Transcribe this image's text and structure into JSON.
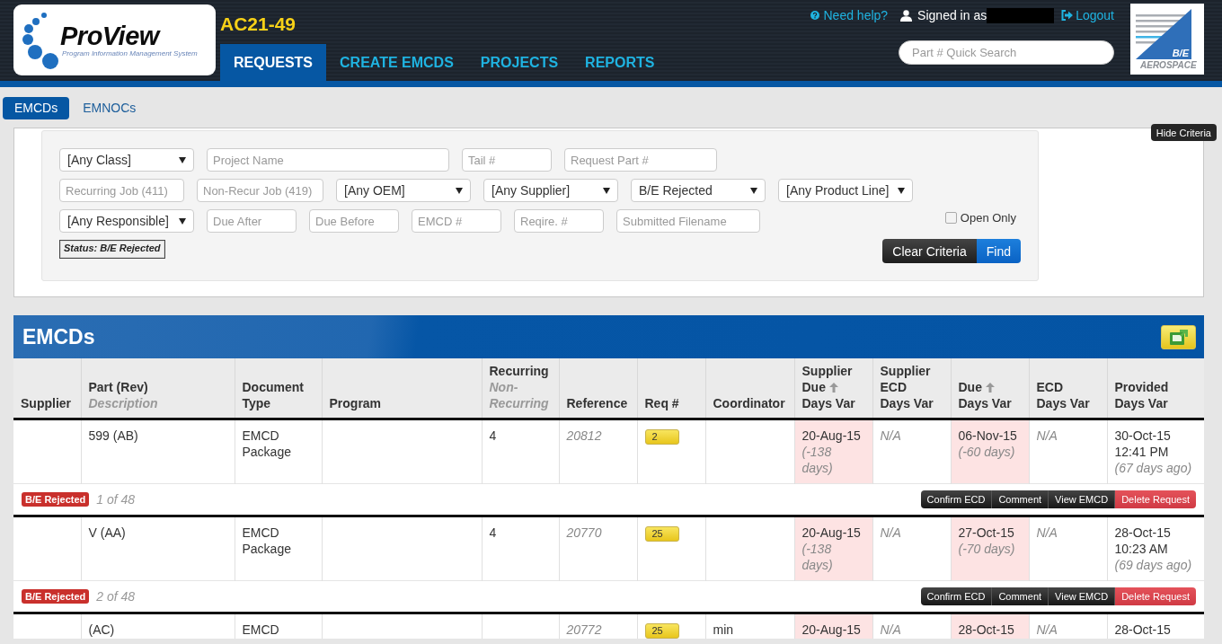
{
  "header": {
    "logo": {
      "name": "ProView",
      "tagline": "Program Information Management System"
    },
    "project_code": "AC21-49",
    "nav": [
      {
        "label": "REQUESTS",
        "selected": true
      },
      {
        "label": "CREATE EMCDS",
        "selected": false
      },
      {
        "label": "PROJECTS",
        "selected": false
      },
      {
        "label": "REPORTS",
        "selected": false
      }
    ],
    "help_link": "Need help?",
    "signed_in_label": "Signed in as",
    "logout_link": "Logout",
    "quick_search": {
      "placeholder": "Part # Quick Search"
    },
    "partner_logo": {
      "mark": "B/E",
      "name": "AEROSPACE"
    }
  },
  "subtabs": [
    {
      "label": "EMCDs",
      "selected": true
    },
    {
      "label": "EMNOCs",
      "selected": false
    }
  ],
  "criteria": {
    "toggle_button": "Hide Criteria",
    "lines": [
      {
        "fields": [
          {
            "kind": "select",
            "value": "[Any Class]"
          },
          {
            "kind": "input",
            "placeholder": "Project Name"
          },
          {
            "kind": "input",
            "placeholder": "Tail #"
          },
          {
            "kind": "input",
            "placeholder": "Request Part #"
          }
        ]
      },
      {
        "fields": [
          {
            "kind": "input",
            "placeholder": "Recurring Job (411)"
          },
          {
            "kind": "input",
            "placeholder": "Non-Recur Job (419)"
          },
          {
            "kind": "select",
            "value": "[Any OEM]"
          },
          {
            "kind": "select",
            "value": "[Any Supplier]"
          },
          {
            "kind": "select",
            "value": "B/E Rejected"
          },
          {
            "kind": "select",
            "value": "[Any Product Line]"
          }
        ]
      },
      {
        "fields": [
          {
            "kind": "select",
            "value": "[Any Responsible]"
          },
          {
            "kind": "input",
            "placeholder": "Due After"
          },
          {
            "kind": "input",
            "placeholder": "Due Before"
          },
          {
            "kind": "input",
            "placeholder": "EMCD #"
          },
          {
            "kind": "input",
            "placeholder": "Reqire. #"
          },
          {
            "kind": "input",
            "placeholder": "Submitted Filename"
          }
        ]
      }
    ],
    "open_only": {
      "label": "Open Only",
      "checked": false
    },
    "status_tag": "Status: B/E Rejected",
    "buttons": [
      {
        "label": "Clear Criteria",
        "kind": "secondary"
      },
      {
        "label": "Find",
        "kind": "primary"
      }
    ]
  },
  "results": {
    "title": "EMCDs",
    "table": {
      "columns": [
        {
          "label": "Supplier",
          "sorted": false
        },
        {
          "label": "Part (Rev)",
          "subtitle": "Description",
          "sorted": false
        },
        {
          "label": "Document Type",
          "sorted": false
        },
        {
          "label": "Program",
          "sorted": false
        },
        {
          "label": "Recurring",
          "subtitle": "Non-Recurring",
          "sorted": false
        },
        {
          "label": "Reference",
          "sorted": false
        },
        {
          "label": "Req #",
          "sorted": false
        },
        {
          "label": "Coordinator",
          "sorted": false
        },
        {
          "label": "Supplier Due",
          "second_line": "Days Var",
          "sorted": true
        },
        {
          "label": "Supplier ECD",
          "second_line": "Days Var",
          "sorted": false
        },
        {
          "label": "Due",
          "second_line": "Days Var",
          "sorted": true
        },
        {
          "label": "ECD",
          "second_line": "Days Var",
          "sorted": false
        },
        {
          "label": "Provided",
          "second_line": "Days Var",
          "sorted": false
        }
      ],
      "rows": [
        {
          "part": "599 (AB)",
          "document_type": "EMCD Package",
          "recurring": "4",
          "reference": "20812",
          "req": "2",
          "supplier_due": {
            "date": "20-Aug-15",
            "variance": "(-138 days)",
            "late": true
          },
          "supplier_ecd": "N/A",
          "due": {
            "date": "06-Nov-15",
            "variance": "(-60 days)",
            "late": true
          },
          "ecd": "N/A",
          "provided": {
            "date": "30-Oct-15",
            "time": "12:41 PM",
            "ago": "(67 days ago)"
          },
          "status": {
            "label": "B/E Rejected",
            "kind": "danger"
          },
          "position": "1 of 48",
          "actions": [
            {
              "label": "Confirm ECD",
              "kind": "default"
            },
            {
              "label": "Comment",
              "kind": "default"
            },
            {
              "label": "View EMCD",
              "kind": "default"
            },
            {
              "label": "Delete Request",
              "kind": "danger"
            }
          ]
        },
        {
          "part": "V (AA)",
          "document_type": "EMCD Package",
          "recurring": "4",
          "reference": "20770",
          "req": "25",
          "supplier_due": {
            "date": "20-Aug-15",
            "variance": "(-138 days)",
            "late": true
          },
          "supplier_ecd": "N/A",
          "due": {
            "date": "27-Oct-15",
            "variance": "(-70 days)",
            "late": true
          },
          "ecd": "N/A",
          "provided": {
            "date": "28-Oct-15",
            "time": "10:23 AM",
            "ago": "(69 days ago)"
          },
          "status": {
            "label": "B/E Rejected",
            "kind": "danger"
          },
          "position": "2 of 48",
          "actions": [
            {
              "label": "Confirm ECD",
              "kind": "default"
            },
            {
              "label": "Comment",
              "kind": "default"
            },
            {
              "label": "View EMCD",
              "kind": "default"
            },
            {
              "label": "Delete Request",
              "kind": "danger"
            }
          ]
        },
        {
          "part": "(AC)",
          "document_type": "EMCD",
          "reference": "20772",
          "req": "25",
          "coordinator": "min",
          "supplier_due": {
            "date": "20-Aug-15",
            "late": true
          },
          "supplier_ecd": "N/A",
          "due": {
            "date": "28-Oct-15",
            "late": true
          },
          "ecd": "N/A",
          "provided": {
            "date": "28-Oct-15"
          }
        }
      ]
    }
  }
}
